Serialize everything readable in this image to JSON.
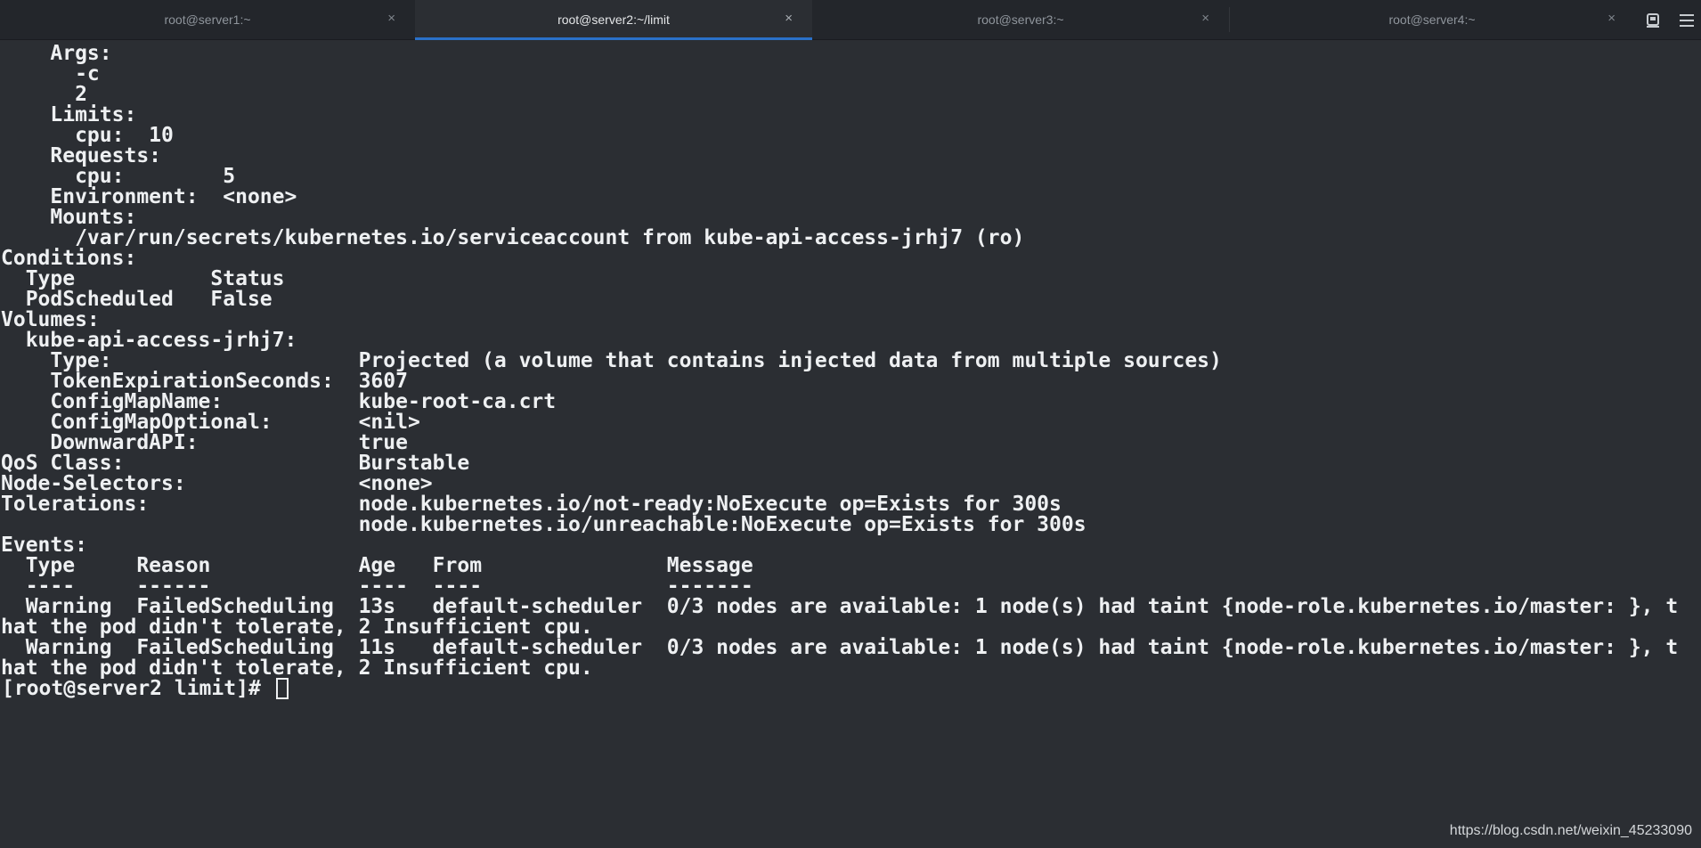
{
  "tabs": [
    {
      "label": "root@server1:~",
      "active": false
    },
    {
      "label": "root@server2:~/limit",
      "active": true
    },
    {
      "label": "root@server3:~",
      "active": false
    },
    {
      "label": "root@server4:~",
      "active": false
    }
  ],
  "tab_close_glyph": "×",
  "icons": {
    "new_tab": "new-tab-icon",
    "menu": "hamburger-menu-icon"
  },
  "terminal": {
    "lines": [
      "    Args:",
      "      -c",
      "      2",
      "    Limits:",
      "      cpu:  10",
      "    Requests:",
      "      cpu:        5",
      "    Environment:  <none>",
      "    Mounts:",
      "      /var/run/secrets/kubernetes.io/serviceaccount from kube-api-access-jrhj7 (ro)",
      "Conditions:",
      "  Type           Status",
      "  PodScheduled   False",
      "Volumes:",
      "  kube-api-access-jrhj7:",
      "    Type:                    Projected (a volume that contains injected data from multiple sources)",
      "    TokenExpirationSeconds:  3607",
      "    ConfigMapName:           kube-root-ca.crt",
      "    ConfigMapOptional:       <nil>",
      "    DownwardAPI:             true",
      "QoS Class:                   Burstable",
      "Node-Selectors:              <none>",
      "Tolerations:                 node.kubernetes.io/not-ready:NoExecute op=Exists for 300s",
      "                             node.kubernetes.io/unreachable:NoExecute op=Exists for 300s",
      "Events:",
      "  Type     Reason            Age   From               Message",
      "  ----     ------            ----  ----               -------",
      "  Warning  FailedScheduling  13s   default-scheduler  0/3 nodes are available: 1 node(s) had taint {node-role.kubernetes.io/master: }, t",
      "hat the pod didn't tolerate, 2 Insufficient cpu.",
      "  Warning  FailedScheduling  11s   default-scheduler  0/3 nodes are available: 1 node(s) had taint {node-role.kubernetes.io/master: }, t",
      "hat the pod didn't tolerate, 2 Insufficient cpu."
    ],
    "prompt": "[root@server2 limit]# "
  },
  "watermark": "https://blog.csdn.net/weixin_45233090",
  "colors": {
    "background": "#2b2e33",
    "tabbar": "#23262b",
    "text": "#eef0f2",
    "active_tab_indicator": "#2a71c9"
  }
}
